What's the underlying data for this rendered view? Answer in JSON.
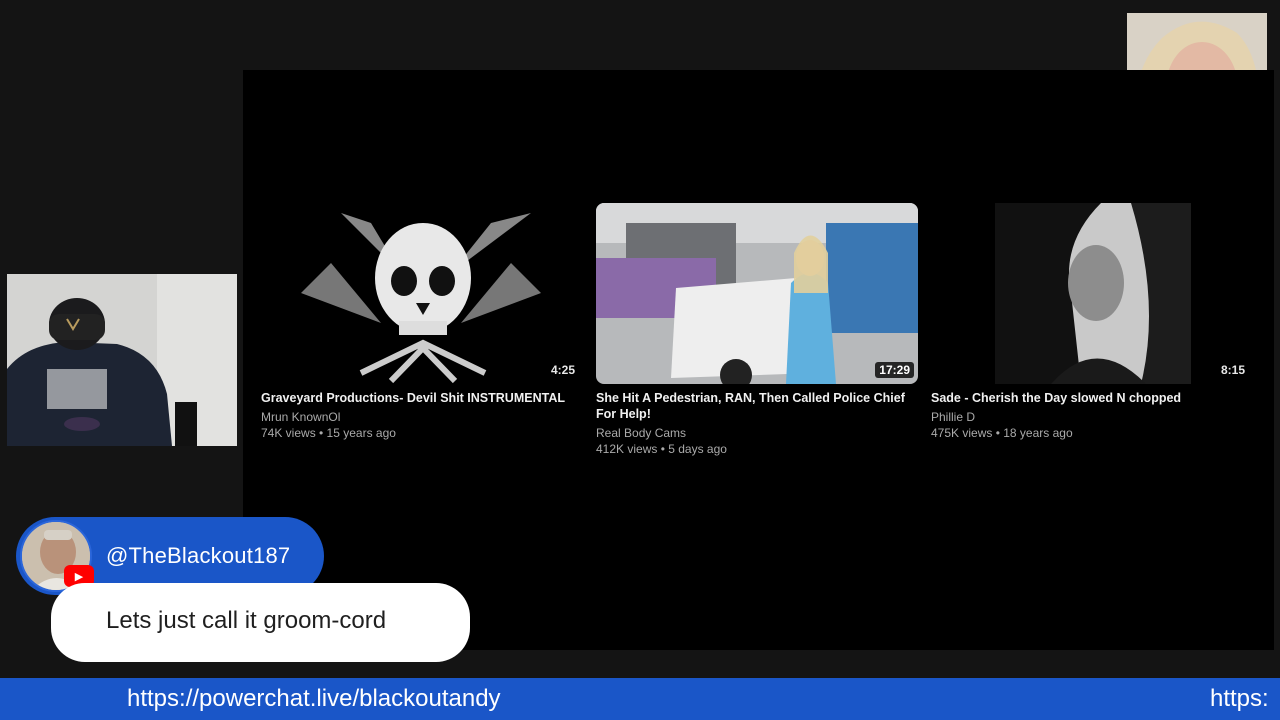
{
  "videos": [
    {
      "title": "Graveyard Productions- Devil Shit INSTRUMENTAL",
      "channel": "Mrun KnownOl",
      "meta": "74K views • 15 years ago",
      "duration": "4:25"
    },
    {
      "title": "She Hit A Pedestrian, RAN, Then Called Police Chief For Help!",
      "channel": "Real Body Cams",
      "meta": "412K views • 5 days ago",
      "duration": "17:29"
    },
    {
      "title": "Sade - Cherish the Day slowed N chopped",
      "channel": "Phillie D",
      "meta": "475K views • 18 years ago",
      "duration": "8:15"
    }
  ],
  "chat": {
    "username": "@TheBlackout187",
    "message": "Lets just call it groom-cord"
  },
  "ticker": {
    "text": "https://powerchat.live/blackoutandy",
    "text_repeat": "https:"
  },
  "icons": {
    "platform_badge": "youtube-icon",
    "play_glyph": "▶"
  },
  "colors": {
    "accent": "#1a56c8",
    "youtube": "#ff0000",
    "stage_bg": "#000000",
    "page_bg": "#141414"
  }
}
